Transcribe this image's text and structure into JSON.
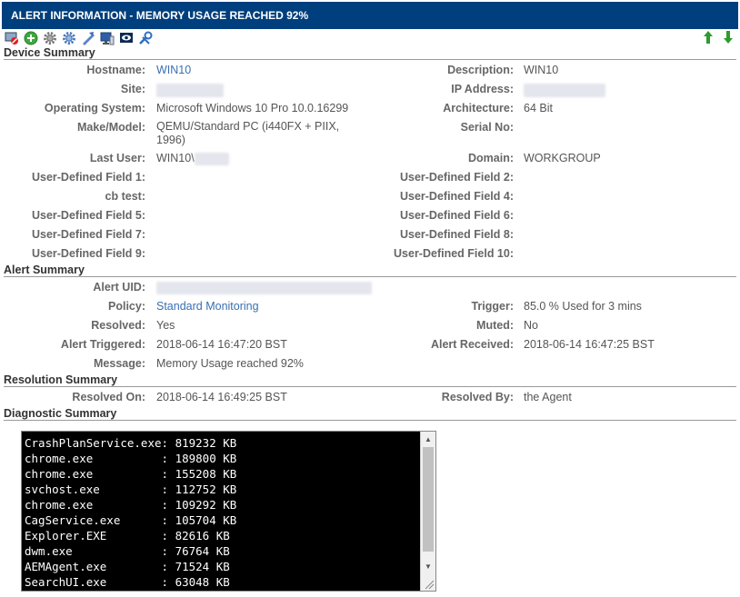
{
  "header": {
    "title": "ALERT INFORMATION - MEMORY USAGE REACHED 92%"
  },
  "toolbar_icons": [
    "delete-device-icon",
    "add-icon",
    "settings-gear-icon",
    "settings-gear-alt-icon",
    "remote-takeover-icon",
    "monitor-icon",
    "view-icon",
    "tools-icon"
  ],
  "device_summary": {
    "heading": "Device Summary",
    "hostname_label": "Hostname:",
    "hostname": "WIN10",
    "description_label": "Description:",
    "description": "WIN10",
    "site_label": "Site:",
    "ip_label": "IP Address:",
    "os_label": "Operating System:",
    "os": "Microsoft Windows 10 Pro 10.0.16299",
    "arch_label": "Architecture:",
    "arch": "64 Bit",
    "make_label": "Make/Model:",
    "make": "QEMU/Standard PC (i440FX + PIIX, 1996)",
    "serial_label": "Serial No:",
    "last_user_label": "Last User:",
    "last_user": "WIN10\\",
    "domain_label": "Domain:",
    "domain": "WORKGROUP",
    "udf1_label": "User-Defined Field 1:",
    "udf2_label": "User-Defined Field 2:",
    "cbtest_label": "cb test:",
    "udf4_label": "User-Defined Field 4:",
    "udf5_label": "User-Defined Field 5:",
    "udf6_label": "User-Defined Field 6:",
    "udf7_label": "User-Defined Field 7:",
    "udf8_label": "User-Defined Field 8:",
    "udf9_label": "User-Defined Field 9:",
    "udf10_label": "User-Defined Field 10:"
  },
  "alert_summary": {
    "heading": "Alert Summary",
    "uid_label": "Alert UID:",
    "policy_label": "Policy:",
    "policy": "Standard Monitoring",
    "trigger_label": "Trigger:",
    "trigger": "85.0 % Used for 3 mins",
    "resolved_label": "Resolved:",
    "resolved": "Yes",
    "muted_label": "Muted:",
    "muted": "No",
    "triggered_label": "Alert Triggered:",
    "triggered": "2018-06-14 16:47:20 BST",
    "received_label": "Alert Received:",
    "received": "2018-06-14 16:47:25 BST",
    "message_label": "Message:",
    "message": "Memory Usage reached 92%"
  },
  "resolution_summary": {
    "heading": "Resolution Summary",
    "resolved_on_label": "Resolved On:",
    "resolved_on": "2018-06-14 16:49:25 BST",
    "resolved_by_label": "Resolved By:",
    "resolved_by": "the Agent"
  },
  "diagnostic_summary": {
    "heading": "Diagnostic Summary",
    "output": "CrashPlanService.exe: 819232 KB\nchrome.exe          : 189800 KB\nchrome.exe          : 155208 KB\nsvchost.exe         : 112752 KB\nchrome.exe          : 109292 KB\nCagService.exe      : 105704 KB\nExplorer.EXE        : 82616 KB\ndwm.exe             : 76764 KB\nAEMAgent.exe        : 71524 KB\nSearchUI.exe        : 63048 KB"
  },
  "colors": {
    "title_bar": "#003f7d",
    "link": "#3a6fb0",
    "nav_arrow": "#2e9b2e"
  }
}
